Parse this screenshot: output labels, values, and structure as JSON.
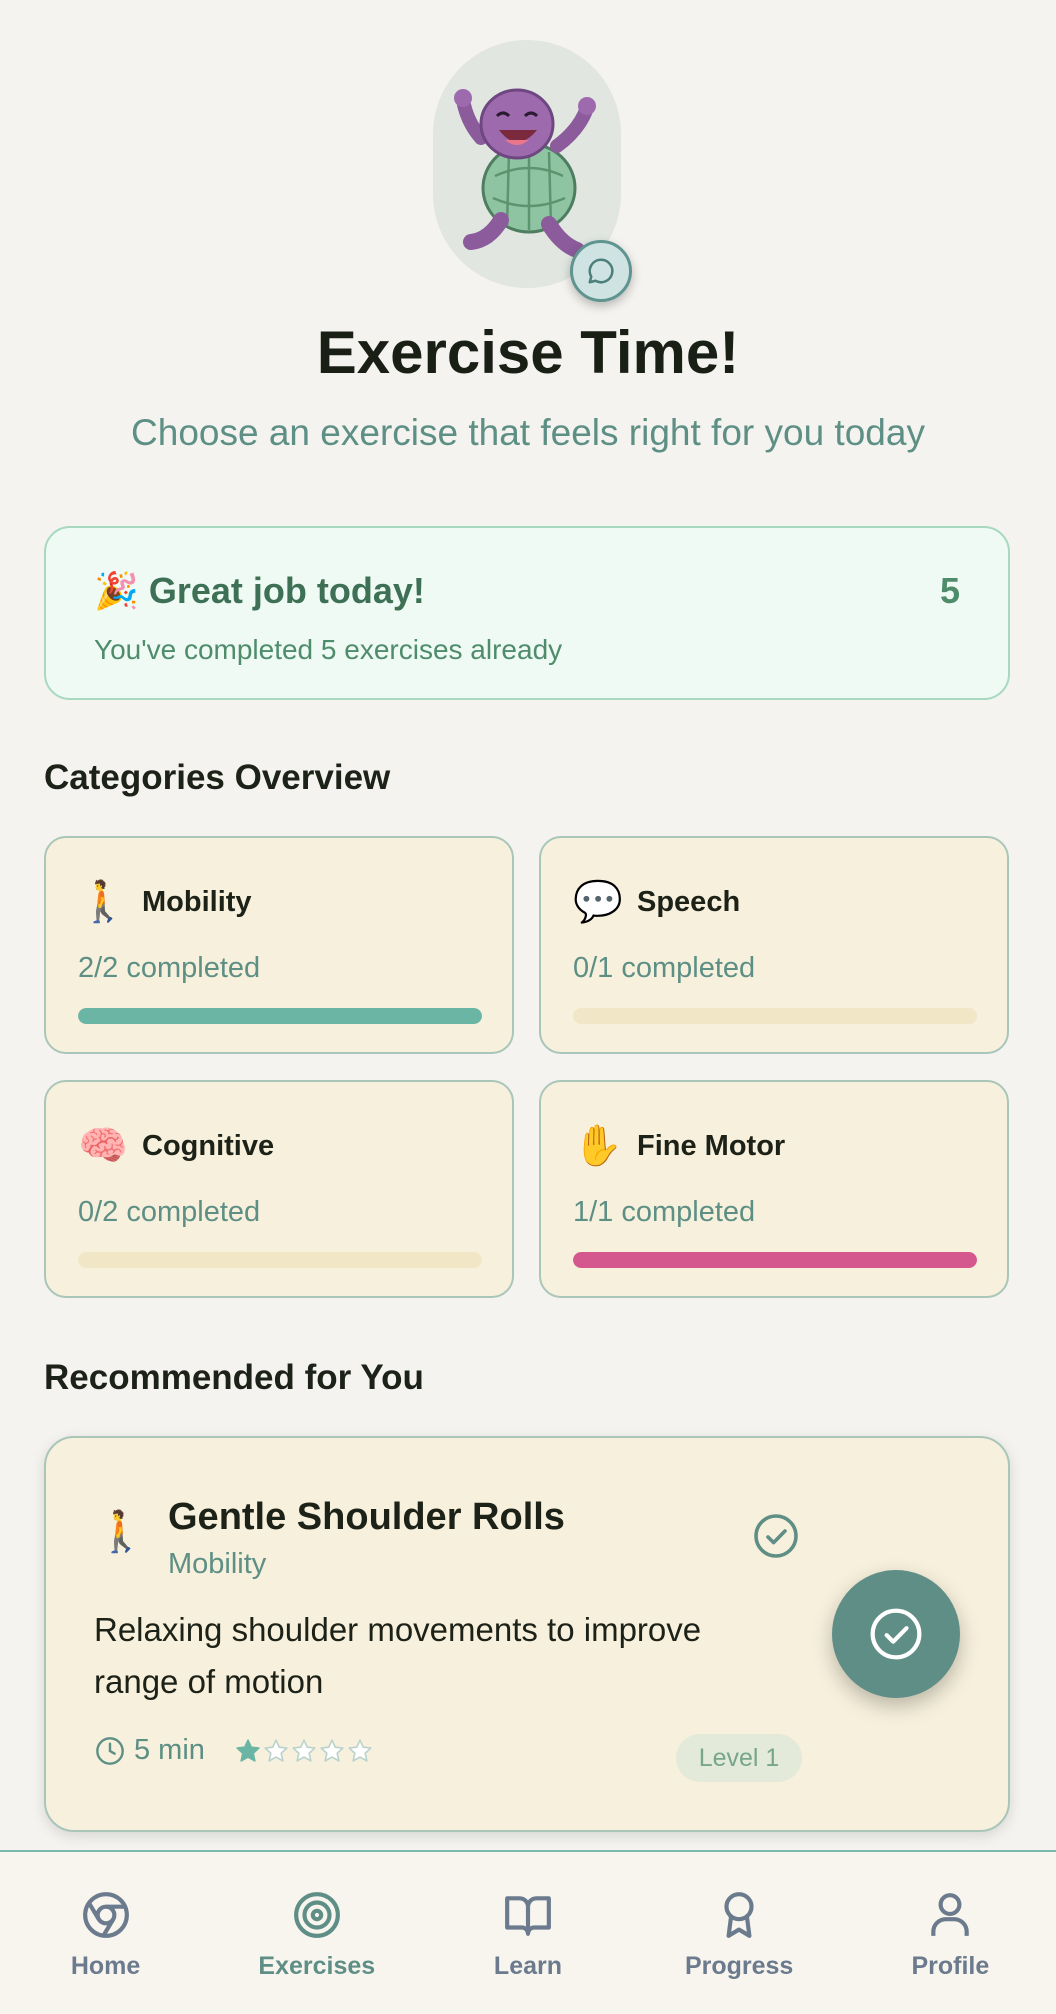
{
  "header": {
    "title": "Exercise Time!",
    "subtitle": "Choose an exercise that feels right for you today",
    "mascot_icon": "turtle-mascot",
    "chat_icon": "chat-bubble-icon"
  },
  "congrats": {
    "emoji": "🎉",
    "heading": "Great job today!",
    "count": "5",
    "message": "You've completed 5 exercises already"
  },
  "categories_overview": {
    "title": "Categories Overview",
    "items": [
      {
        "emoji": "🚶",
        "name": "Mobility",
        "status": "2/2 completed",
        "progress": 1.0,
        "color": "#6bb5a4"
      },
      {
        "emoji": "💬",
        "name": "Speech",
        "status": "0/1 completed",
        "progress": 0.0,
        "color": "#6bb5a4"
      },
      {
        "emoji": "🧠",
        "name": "Cognitive",
        "status": "0/2 completed",
        "progress": 0.0,
        "color": "#6bb5a4"
      },
      {
        "emoji": "✋",
        "name": "Fine Motor",
        "status": "1/1 completed",
        "progress": 1.0,
        "color": "#d4588e"
      }
    ]
  },
  "recommended": {
    "title": "Recommended for You",
    "exercise": {
      "emoji": "🚶",
      "name": "Gentle Shoulder Rolls",
      "category": "Mobility",
      "description": "Relaxing shoulder movements to improve range of motion",
      "duration": "5 min",
      "difficulty_stars": 1,
      "difficulty_max": 5,
      "level": "Level 1"
    }
  },
  "nav": {
    "items": [
      {
        "label": "Home",
        "icon": "home-icon"
      },
      {
        "label": "Exercises",
        "icon": "target-icon",
        "active": true
      },
      {
        "label": "Learn",
        "icon": "book-icon"
      },
      {
        "label": "Progress",
        "icon": "award-icon"
      },
      {
        "label": "Profile",
        "icon": "user-icon"
      }
    ]
  },
  "colors": {
    "accent": "#5f8e86",
    "mobility": "#6bb5a4",
    "fine_motor": "#d4588e",
    "card_bg": "#f7f0dc"
  }
}
